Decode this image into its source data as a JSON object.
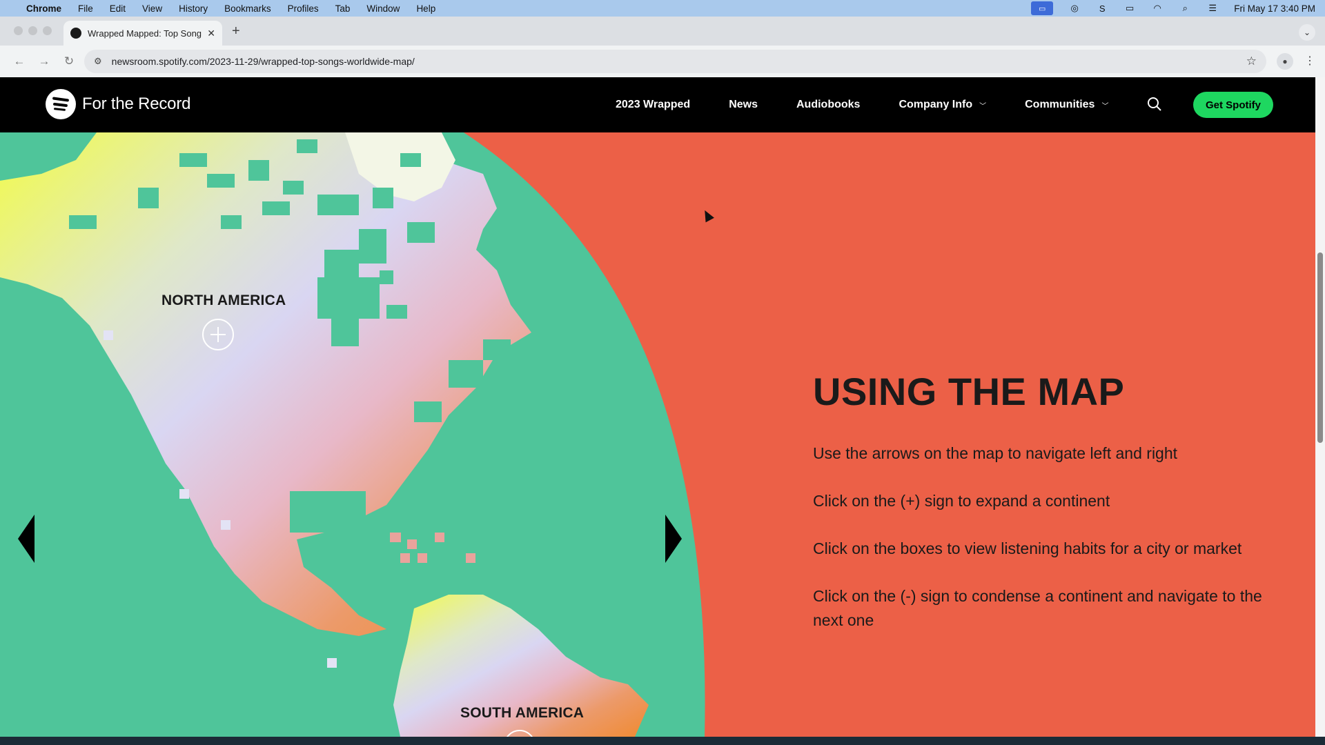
{
  "menubar": {
    "app": "Chrome",
    "items": [
      "File",
      "Edit",
      "View",
      "History",
      "Bookmarks",
      "Profiles",
      "Tab",
      "Window",
      "Help"
    ],
    "clock": "Fri May 17  3:40 PM"
  },
  "browser": {
    "tab_title": "Wrapped Mapped: Top Songs",
    "url": "newsroom.spotify.com/2023-11-29/wrapped-top-songs-worldwide-map/"
  },
  "site": {
    "logo_text": "For the Record",
    "nav": [
      {
        "label": "2023 Wrapped",
        "dropdown": false
      },
      {
        "label": "News",
        "dropdown": false
      },
      {
        "label": "Audiobooks",
        "dropdown": false
      },
      {
        "label": "Company Info",
        "dropdown": true
      },
      {
        "label": "Communities",
        "dropdown": true
      }
    ],
    "cta": "Get Spotify"
  },
  "map": {
    "labels": {
      "north_america": "NORTH AMERICA",
      "south_america": "SOUTH AMERICA"
    }
  },
  "info": {
    "heading": "USING THE MAP",
    "instructions": [
      "Use the arrows on the map to navigate left and right",
      "Click on the (+) sign to expand a continent",
      "Click on the boxes to view listening habits for a city or market",
      "Click on the (-) sign to condense a continent and navigate to the next one"
    ]
  },
  "colors": {
    "background": "#ec6047",
    "ocean": "#4fc59a",
    "header": "#000000",
    "cta": "#1ed760"
  }
}
